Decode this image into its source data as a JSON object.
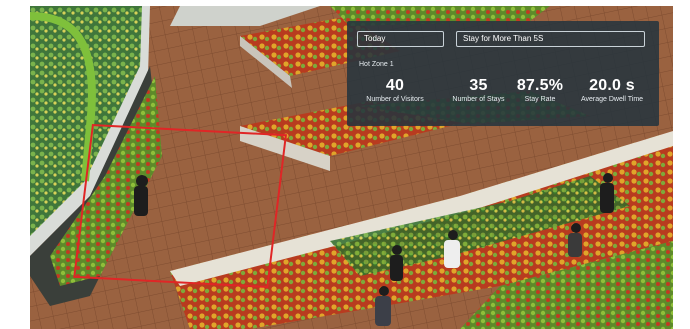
{
  "filters": {
    "date_range": "Today",
    "stay_rule": "Stay for More Than 5S"
  },
  "zone": {
    "name": "Hot Zone 1"
  },
  "stats": [
    {
      "value": "40",
      "label": "Number of Visitors"
    },
    {
      "value": "35",
      "label": "Number of Stays"
    },
    {
      "value": "87.5%",
      "label": "Stay Rate"
    },
    {
      "value": "20.0 s",
      "label": "Average Dwell Time"
    }
  ],
  "colors": {
    "zone_outline": "#e02626",
    "panel_background": "#26343e"
  }
}
